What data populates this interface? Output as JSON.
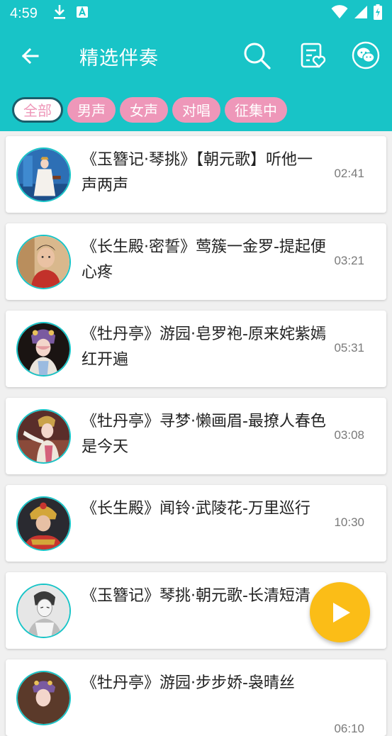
{
  "status_bar": {
    "time": "4:59",
    "icons_left": [
      "download-icon",
      "notification-a-icon"
    ],
    "icons_right": [
      "wifi-icon",
      "cell-signal-icon",
      "battery-icon"
    ]
  },
  "app_bar": {
    "title": "精选伴奏",
    "back_icon": "arrow-left-icon",
    "actions": [
      "search-icon",
      "favorites-icon",
      "wechat-icon"
    ]
  },
  "filter_tabs": [
    {
      "label": "全部",
      "selected": true
    },
    {
      "label": "男声",
      "selected": false
    },
    {
      "label": "女声",
      "selected": false
    },
    {
      "label": "对唱",
      "selected": false
    },
    {
      "label": "征集中",
      "selected": false
    }
  ],
  "songs": [
    {
      "title": "《玉簪记·琴挑》【朝元歌】听他一声两声",
      "duration": "02:41"
    },
    {
      "title": "《长生殿·密誓》莺簇一金罗-提起便心疼",
      "duration": "03:21"
    },
    {
      "title": "《牡丹亭》游园·皂罗袍-原来姹紫嫣红开遍",
      "duration": "05:31"
    },
    {
      "title": "《牡丹亭》寻梦·懒画眉-最撩人春色是今天",
      "duration": "03:08"
    },
    {
      "title": "《长生殿》闻铃·武陵花-万里巡行",
      "duration": "10:30"
    },
    {
      "title": "《玉簪记》琴挑·朝元歌-长清短清",
      "duration": ""
    },
    {
      "title": "《牡丹亭》游园·步步娇-袅晴丝",
      "duration": "06:10"
    }
  ],
  "fab": {
    "icon": "play-icon"
  },
  "colors": {
    "primary": "#18c4c7",
    "chip": "#ee97b9",
    "fab": "#fbbd17"
  }
}
